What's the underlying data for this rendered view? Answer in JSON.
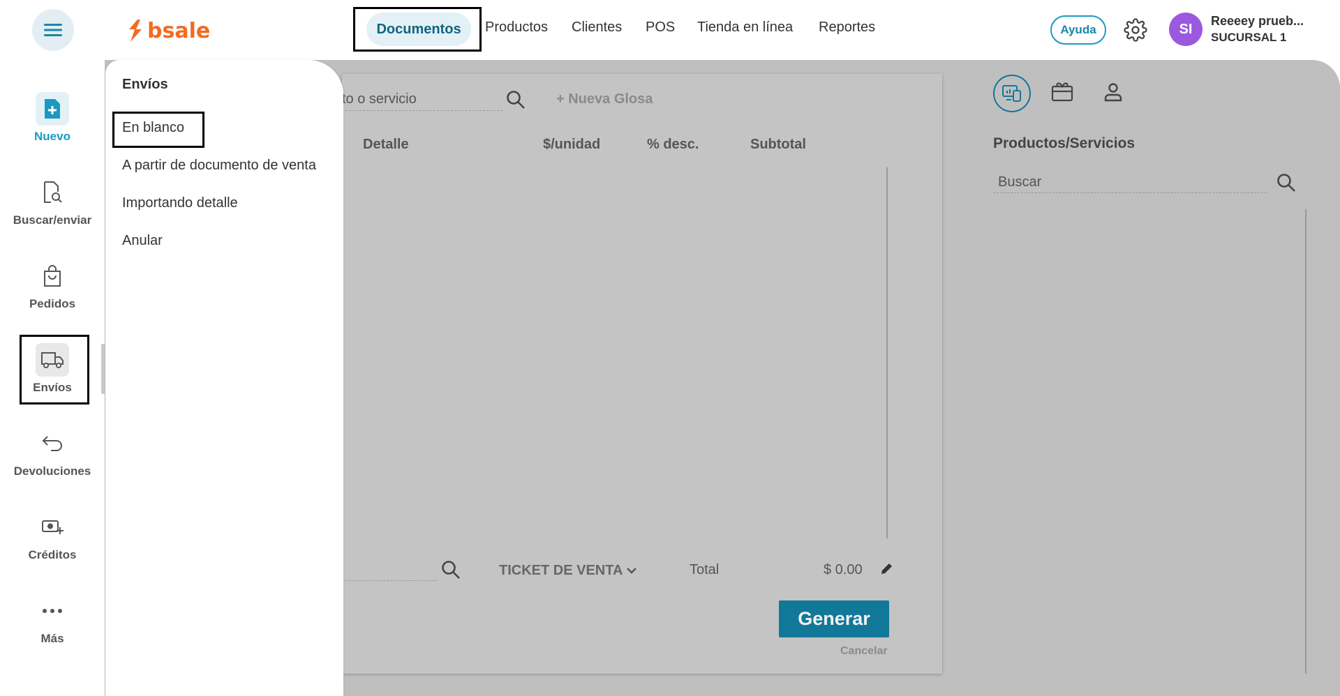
{
  "header": {
    "logo_text": "bsale",
    "nav": [
      {
        "label": "Documentos"
      },
      {
        "label": "Productos"
      },
      {
        "label": "Clientes"
      },
      {
        "label": "POS"
      },
      {
        "label": "Tienda en línea"
      },
      {
        "label": "Reportes"
      }
    ],
    "help_label": "Ayuda",
    "user": {
      "initials": "SI",
      "name": "Reeeey prueb...",
      "branch": "SUCURSAL 1"
    }
  },
  "sidebar": {
    "items": [
      {
        "label": "Nuevo",
        "icon": "file-plus-icon"
      },
      {
        "label": "Buscar/enviar",
        "icon": "file-search-icon"
      },
      {
        "label": "Pedidos",
        "icon": "bag-icon"
      },
      {
        "label": "Envíos",
        "icon": "truck-icon"
      },
      {
        "label": "Devoluciones",
        "icon": "return-arrow-icon"
      },
      {
        "label": "Créditos",
        "icon": "credit-icon"
      },
      {
        "label": "Más",
        "icon": "more-dots-icon"
      }
    ]
  },
  "dropdown": {
    "title": "Envíos",
    "items": [
      {
        "label": "En blanco"
      },
      {
        "label": "A partir de documento de venta"
      },
      {
        "label": "Importando detalle"
      },
      {
        "label": "Anular"
      }
    ]
  },
  "document": {
    "search_placeholder_fragment": "to o servicio",
    "new_gloss_label": "+ Nueva Glosa",
    "columns": [
      "Detalle",
      "$/unidad",
      "% desc.",
      "Subtotal"
    ],
    "doc_type": "TICKET DE VENTA",
    "total_label": "Total",
    "total_value": "$ 0.00",
    "generate_label": "Generar",
    "cancel_label": "Cancelar"
  },
  "right_panel": {
    "title": "Productos/Servicios",
    "search_placeholder": "Buscar"
  },
  "colors": {
    "brand_orange": "#f26b21",
    "primary_teal": "#12789a",
    "avatar_purple": "#9b59e0"
  }
}
